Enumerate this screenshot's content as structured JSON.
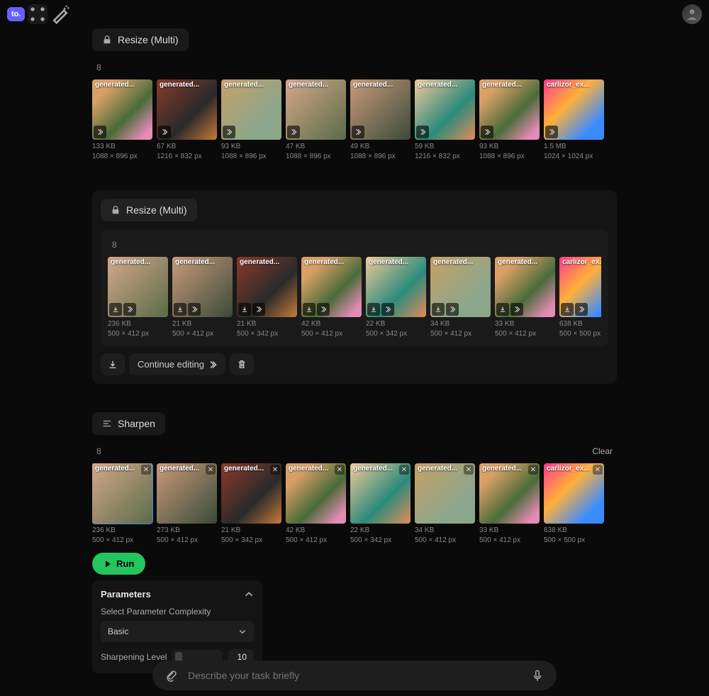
{
  "app": {
    "logo": "to."
  },
  "section1": {
    "title": "Resize (Multi)",
    "count": "8",
    "items": [
      {
        "name": "generated...",
        "size": "133 KB",
        "dims": "1088 × 896 px",
        "style": "gi-giraffe"
      },
      {
        "name": "generated...",
        "size": "67 KB",
        "dims": "1216 × 832 px",
        "style": "gi-cat"
      },
      {
        "name": "generated...",
        "size": "93 KB",
        "dims": "1088 × 896 px",
        "style": "gi-giraffe2"
      },
      {
        "name": "generated...",
        "size": "47 KB",
        "dims": "1088 × 896 px",
        "style": "gi-face1"
      },
      {
        "name": "generated...",
        "size": "49 KB",
        "dims": "1088 × 896 px",
        "style": "gi-face2"
      },
      {
        "name": "generated...",
        "size": "59 KB",
        "dims": "1216 × 832 px",
        "style": "gi-anime"
      },
      {
        "name": "generated...",
        "size": "93 KB",
        "dims": "1088 × 896 px",
        "style": "gi-giraffe"
      },
      {
        "name": "carlizor_ex...",
        "size": "1.5 MB",
        "dims": "1024 × 1024 px",
        "style": "gi-abstract"
      }
    ]
  },
  "section2": {
    "title": "Resize (Multi)",
    "count": "8",
    "continue": "Continue editing",
    "items": [
      {
        "name": "generated...",
        "size": "236 KB",
        "dims": "500 × 412 px",
        "style": "gi-face1"
      },
      {
        "name": "generated...",
        "size": "21 KB",
        "dims": "500 × 412 px",
        "style": "gi-face2"
      },
      {
        "name": "generated...",
        "size": "21 KB",
        "dims": "500 × 342 px",
        "style": "gi-cat"
      },
      {
        "name": "generated...",
        "size": "42 KB",
        "dims": "500 × 412 px",
        "style": "gi-giraffe"
      },
      {
        "name": "generated...",
        "size": "22 KB",
        "dims": "500 × 342 px",
        "style": "gi-anime"
      },
      {
        "name": "generated...",
        "size": "34 KB",
        "dims": "500 × 412 px",
        "style": "gi-giraffe2"
      },
      {
        "name": "generated...",
        "size": "33 KB",
        "dims": "500 × 412 px",
        "style": "gi-giraffe"
      },
      {
        "name": "carlizor_ex...",
        "size": "638 KB",
        "dims": "500 × 500 px",
        "style": "gi-abstract"
      }
    ]
  },
  "section3": {
    "title": "Sharpen",
    "count": "8",
    "clear": "Clear",
    "run": "Run",
    "params": {
      "title": "Parameters",
      "complexity_label": "Select Parameter Complexity",
      "complexity_value": "Basic",
      "sharp_label": "Sharpening Level",
      "sharp_value": "10"
    },
    "items": [
      {
        "name": "generated...",
        "size": "236 KB",
        "dims": "500 × 412 px",
        "style": "gi-face1",
        "selected": true
      },
      {
        "name": "generated...",
        "size": "273 KB",
        "dims": "500 × 412 px",
        "style": "gi-face2"
      },
      {
        "name": "generated...",
        "size": "21 KB",
        "dims": "500 × 342 px",
        "style": "gi-cat"
      },
      {
        "name": "generated...",
        "size": "42 KB",
        "dims": "500 × 412 px",
        "style": "gi-giraffe"
      },
      {
        "name": "generated...",
        "size": "22 KB",
        "dims": "500 × 342 px",
        "style": "gi-anime"
      },
      {
        "name": "generated...",
        "size": "34 KB",
        "dims": "500 × 412 px",
        "style": "gi-giraffe2"
      },
      {
        "name": "generated...",
        "size": "33 KB",
        "dims": "500 × 412 px",
        "style": "gi-giraffe"
      },
      {
        "name": "carlizor_ex...",
        "size": "638 KB",
        "dims": "500 × 500 px",
        "style": "gi-abstract"
      }
    ]
  },
  "prompt": {
    "placeholder": "Describe your task briefly"
  }
}
